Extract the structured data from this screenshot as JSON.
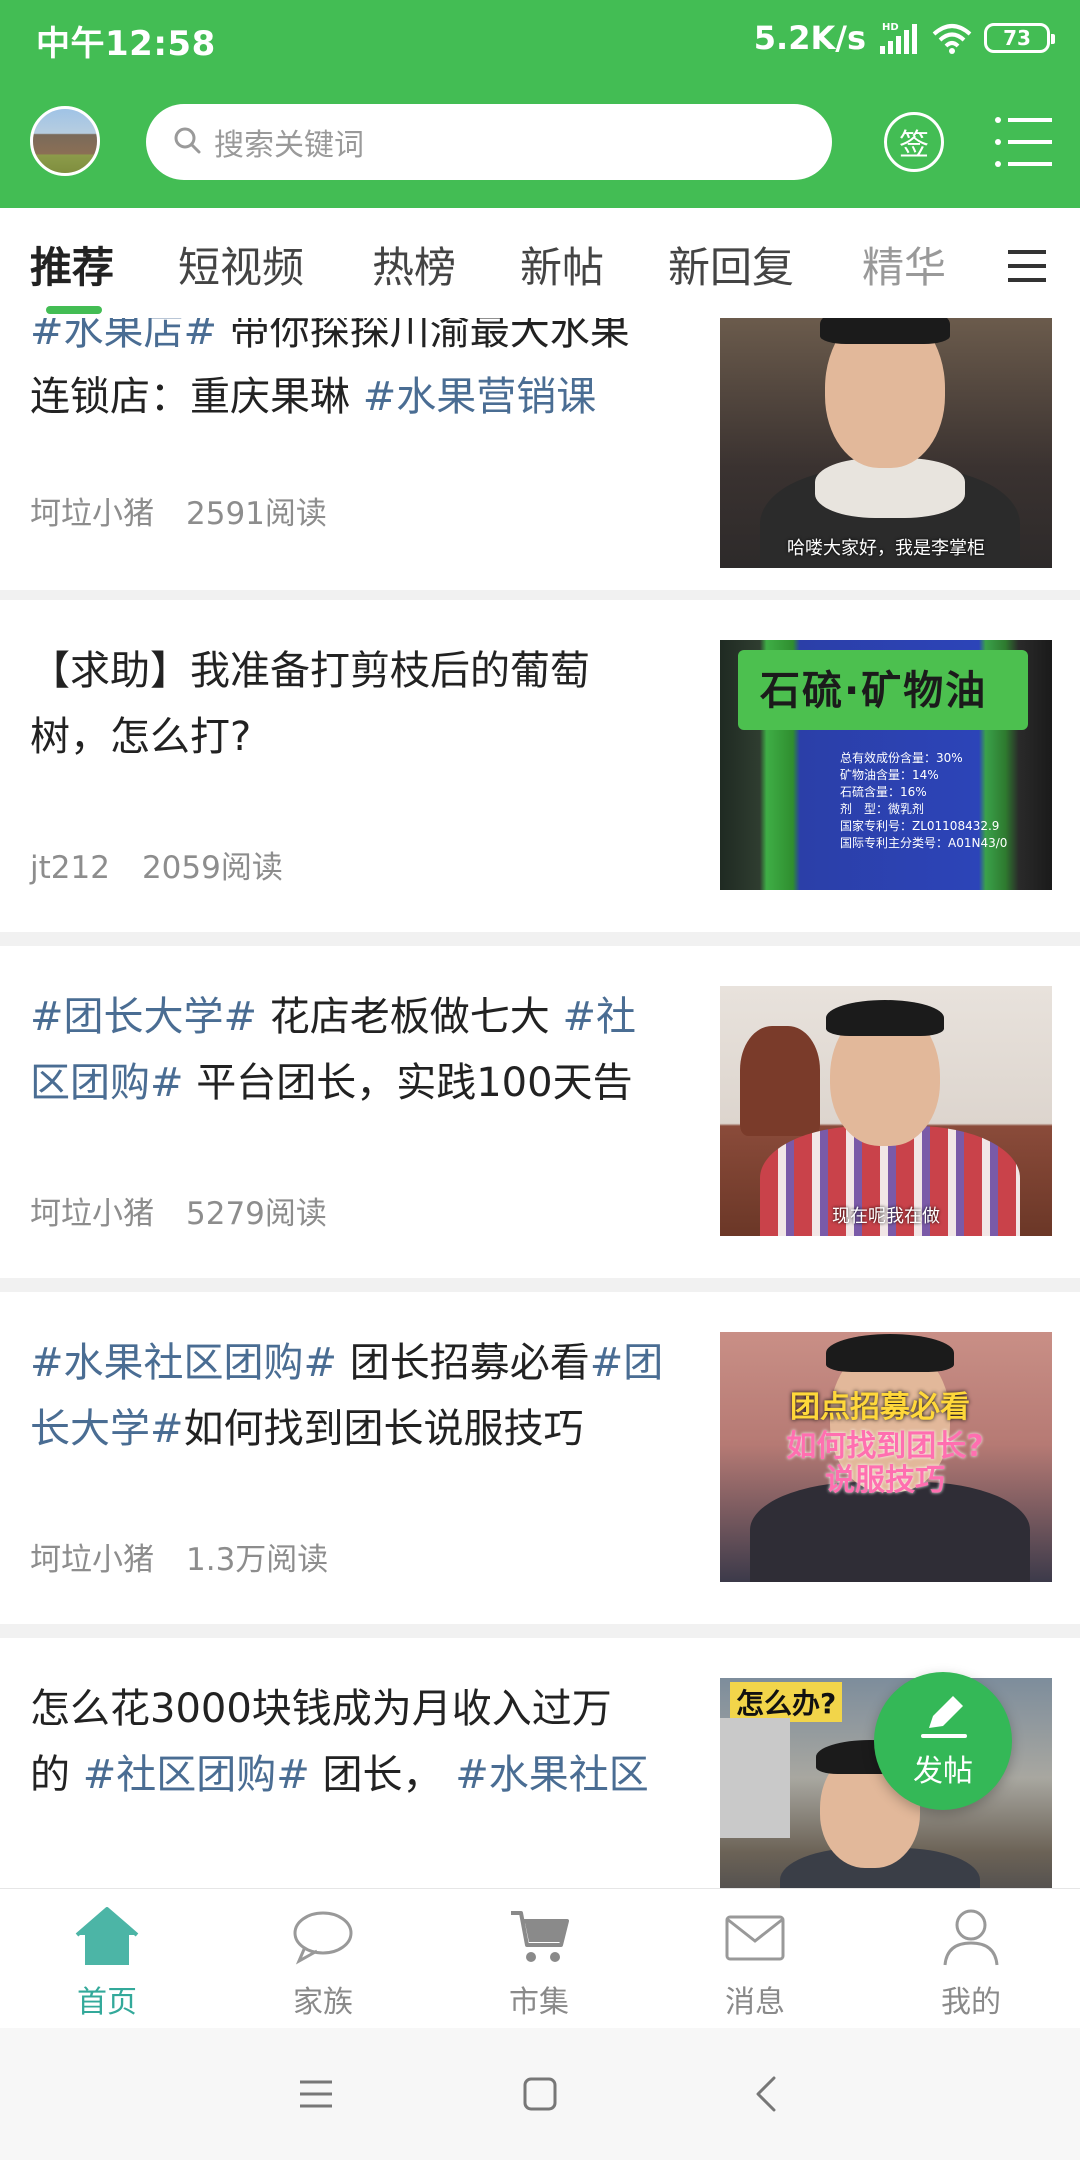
{
  "status_bar": {
    "time": "中午12:58",
    "network_speed": "5.2K/s",
    "network_type": "HD",
    "battery": "73"
  },
  "header": {
    "search_placeholder": "搜索关键词",
    "sign_label": "签"
  },
  "tabs": [
    {
      "label": "推荐",
      "active": true
    },
    {
      "label": "短视频",
      "active": false
    },
    {
      "label": "热榜",
      "active": false
    },
    {
      "label": "新帖",
      "active": false
    },
    {
      "label": "新回复",
      "active": false
    },
    {
      "label": "精华",
      "active": false
    }
  ],
  "posts": [
    {
      "title_line1_tag": "#水果店#",
      "title_line1_text": " 带你探探川渝最大水果",
      "title_line2_text": "连锁店：重庆果琳 ",
      "title_line2_tag": "#水果营销课",
      "author": "坷垃小猪",
      "reads": "2591阅读",
      "thumb_caption": "哈喽大家好，我是李掌柜"
    },
    {
      "title_line1_text": "【求助】我准备打剪枝后的葡萄",
      "title_line2_text": "树，怎么打?",
      "author": "jt212",
      "reads": "2059阅读",
      "thumb_label": "石硫·矿物油",
      "thumb_small_text": [
        "总有效成份含量：30%",
        "矿物油含量：14%",
        "石硫含量：16%",
        "剂　型：微乳剂",
        "国家专利号：ZL01108432.9",
        "国际专利主分类号：A01N43/0"
      ]
    },
    {
      "title_line1_tag_a": " #团长大学#",
      "title_line1_text": " 花店老板做七大 ",
      "title_line1_tag_b": "#社",
      "title_line2_tag": "区团购#",
      "title_line2_text": " 平台团长，实践100天告",
      "author": "坷垃小猪",
      "reads": "5279阅读",
      "thumb_caption": "现在呢我在做"
    },
    {
      "title_line1_tag_a": "#水果社区团购#",
      "title_line1_text": " 团长招募必看",
      "title_line1_tag_b": "#团",
      "title_line2_tag": "长大学#",
      "title_line2_text": "如何找到团长说服技巧",
      "author": "坷垃小猪",
      "reads": "1.3万阅读",
      "thumb_caption_yellow": "团点招募必看",
      "thumb_caption_pink": "如何找到团长?\n说服技巧"
    },
    {
      "title_line1_text": "怎么花3000块钱成为月收入过万",
      "title_line2_text_a": "的 ",
      "title_line2_tag_a": "#社区团购#",
      "title_line2_text_b": " 团长， ",
      "title_line2_tag_b": "#水果社区",
      "thumb_caption_top": "怎么办?"
    }
  ],
  "fab": {
    "label": "发帖"
  },
  "bottom_nav": [
    {
      "label": "首页",
      "icon": "home-icon",
      "active": true
    },
    {
      "label": "家族",
      "icon": "chat-bubble-icon",
      "active": false
    },
    {
      "label": "市集",
      "icon": "cart-icon",
      "active": false
    },
    {
      "label": "消息",
      "icon": "mail-icon",
      "active": false
    },
    {
      "label": "我的",
      "icon": "user-icon",
      "active": false
    }
  ],
  "colors": {
    "brand_green": "#43bd54",
    "tag_blue": "#4a6d93",
    "nav_active": "#33a99a"
  }
}
